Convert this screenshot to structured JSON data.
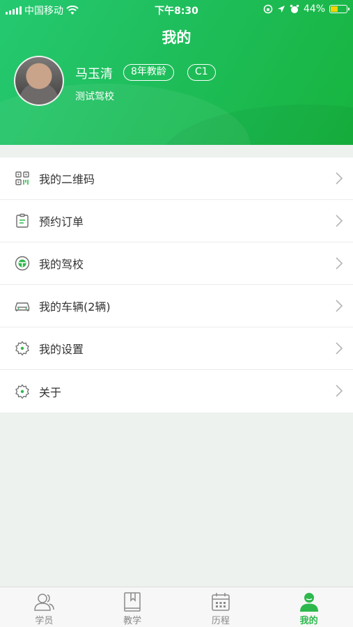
{
  "status_bar": {
    "carrier": "中国移动",
    "time": "下午8:30",
    "battery": "44%",
    "battery_level": 0.44
  },
  "header": {
    "title": "我的",
    "user_name": "马玉清",
    "years_badge": "8年教龄",
    "license_badge": "C1",
    "school": "测试驾校"
  },
  "menu": {
    "items": [
      {
        "label": "我的二维码",
        "icon": "qr-code-icon"
      },
      {
        "label": "预约订单",
        "icon": "clipboard-icon"
      },
      {
        "label": "我的驾校",
        "icon": "steering-wheel-icon"
      },
      {
        "label": "我的车辆(2辆)",
        "icon": "car-icon"
      },
      {
        "label": "我的设置",
        "icon": "gear-icon"
      },
      {
        "label": "关于",
        "icon": "gear-icon"
      }
    ]
  },
  "tabbar": {
    "tabs": [
      {
        "label": "学员",
        "icon": "students-icon"
      },
      {
        "label": "教学",
        "icon": "book-icon"
      },
      {
        "label": "历程",
        "icon": "calendar-icon"
      },
      {
        "label": "我的",
        "icon": "person-icon",
        "active": true
      }
    ]
  },
  "colors": {
    "accent": "#2db84c",
    "header_gradient_start": "#25c970",
    "header_gradient_end": "#17b43e",
    "icon_gray": "#6b6b6b"
  }
}
